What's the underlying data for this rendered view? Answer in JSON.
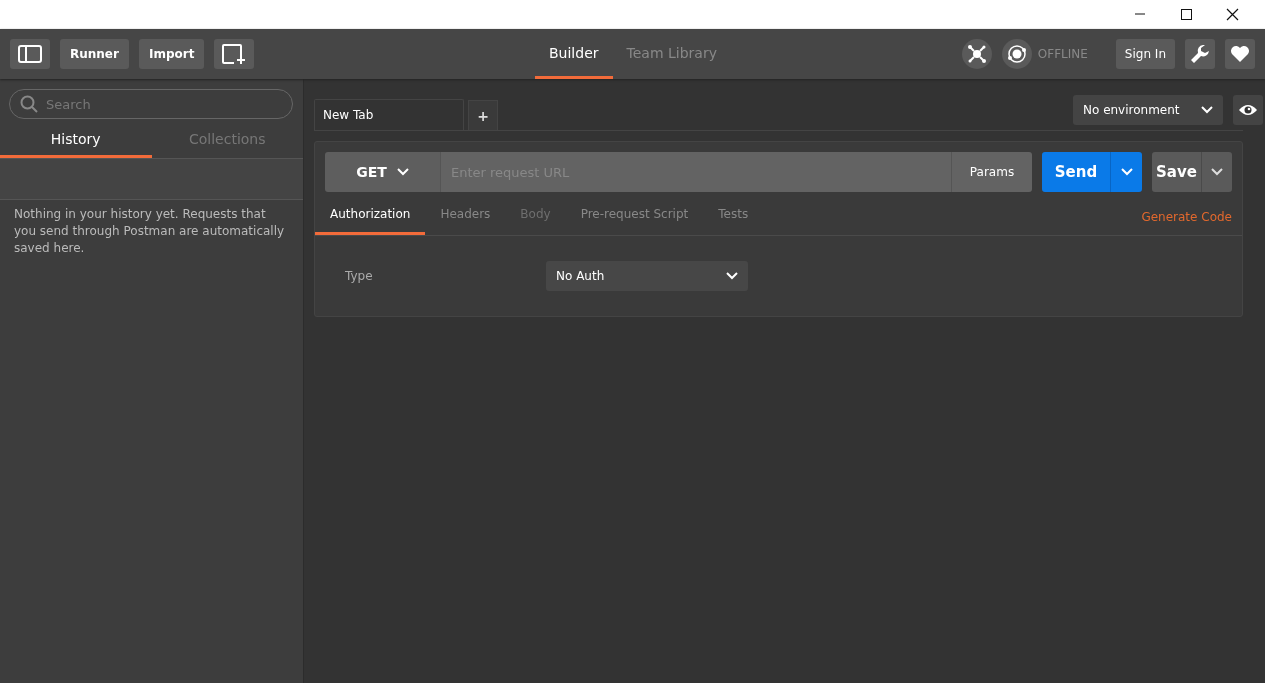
{
  "header": {
    "buttons": [
      "Runner",
      "Import"
    ],
    "nav_tabs": [
      {
        "label": "Builder",
        "selected": true
      },
      {
        "label": "Team Library",
        "selected": false
      }
    ],
    "status": "OFFLINE",
    "sign_in": "Sign In"
  },
  "sidebar": {
    "search": {
      "placeholder": "Search"
    },
    "tabs": [
      {
        "label": "History",
        "selected": true
      },
      {
        "label": "Collections",
        "selected": false
      }
    ],
    "empty_message": "Nothing in your history yet. Requests that you send through Postman are automatically saved here."
  },
  "request_tabs": [
    {
      "label": "New Tab",
      "selected": true
    }
  ],
  "add_tab": "+",
  "environment": "No environment",
  "request": {
    "method": "GET",
    "url": {
      "placeholder": "Enter request URL"
    },
    "params": "Params",
    "send": "Send",
    "save": "Save",
    "tabs": [
      {
        "label": "Authorization",
        "selected": true,
        "disabled": false
      },
      {
        "label": "Headers",
        "selected": false,
        "disabled": false
      },
      {
        "label": "Body",
        "selected": false,
        "disabled": true
      },
      {
        "label": "Pre-request Script",
        "selected": false,
        "disabled": false
      },
      {
        "label": "Tests",
        "selected": false,
        "disabled": false
      }
    ],
    "generate_code": "Generate Code",
    "auth": {
      "label": "Type",
      "value": "No Auth"
    }
  }
}
